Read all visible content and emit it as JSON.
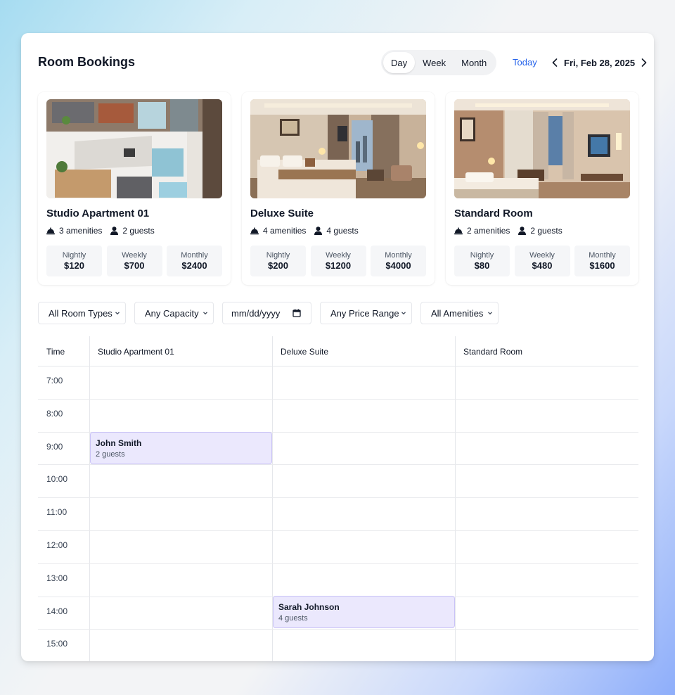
{
  "header": {
    "title": "Room Bookings",
    "views": [
      "Day",
      "Week",
      "Month"
    ],
    "active_view": "Day",
    "today_label": "Today",
    "current_date": "Fri, Feb 28, 2025"
  },
  "rooms": [
    {
      "name": "Studio Apartment 01",
      "amenities": "3 amenities",
      "guests": "2 guests",
      "prices": [
        {
          "label": "Nightly",
          "value": "$120"
        },
        {
          "label": "Weekly",
          "value": "$700"
        },
        {
          "label": "Monthly",
          "value": "$2400"
        }
      ]
    },
    {
      "name": "Deluxe Suite",
      "amenities": "4 amenities",
      "guests": "4 guests",
      "prices": [
        {
          "label": "Nightly",
          "value": "$200"
        },
        {
          "label": "Weekly",
          "value": "$1200"
        },
        {
          "label": "Monthly",
          "value": "$4000"
        }
      ]
    },
    {
      "name": "Standard Room",
      "amenities": "2 amenities",
      "guests": "2 guests",
      "prices": [
        {
          "label": "Nightly",
          "value": "$80"
        },
        {
          "label": "Weekly",
          "value": "$480"
        },
        {
          "label": "Monthly",
          "value": "$1600"
        }
      ]
    }
  ],
  "filters": {
    "room_type": "All Room Types",
    "capacity": "Any Capacity",
    "date_placeholder": "mm/dd/yyyy",
    "price_range": "Any Price Range",
    "amenities": "All Amenities"
  },
  "schedule": {
    "time_header": "Time",
    "columns": [
      "Studio Apartment 01",
      "Deluxe Suite",
      "Standard Room"
    ],
    "times": [
      "7:00",
      "8:00",
      "9:00",
      "10:00",
      "11:00",
      "12:00",
      "13:00",
      "14:00",
      "15:00"
    ],
    "bookings": [
      {
        "guest": "John Smith",
        "guests": "2 guests",
        "room": "Studio Apartment 01",
        "time": "9:00"
      },
      {
        "guest": "Sarah Johnson",
        "guests": "4 guests",
        "room": "Deluxe Suite",
        "time": "14:00"
      }
    ]
  },
  "icons": {
    "amenities": "service-bell-icon",
    "guests": "user-icon",
    "prev": "chevron-left-icon",
    "next": "chevron-right-icon",
    "dropdown": "chevron-down-icon",
    "date": "calendar-icon"
  },
  "colors": {
    "accent_link": "#2563eb",
    "booking_fill": "#ebe8fd",
    "booking_border": "#c9c2f6"
  }
}
